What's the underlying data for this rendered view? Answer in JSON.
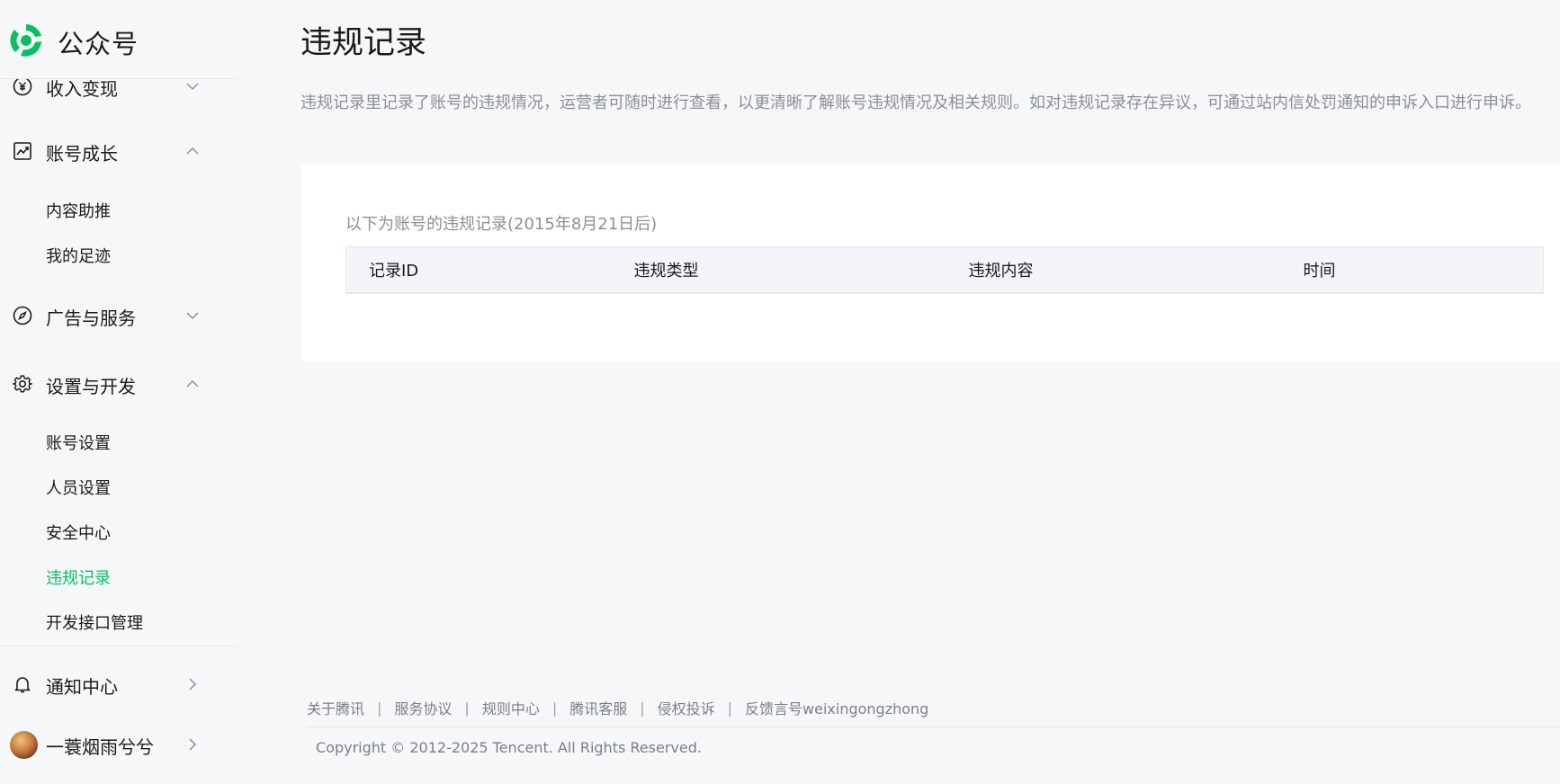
{
  "app": {
    "name": "公众号"
  },
  "sidebar": {
    "groups": [
      {
        "label": "收入变现",
        "icon": "yen-circle-icon",
        "state": "collapsed"
      },
      {
        "label": "账号成长",
        "icon": "trend-chart-icon",
        "state": "expanded"
      },
      {
        "label": "广告与服务",
        "icon": "compass-icon",
        "state": "collapsed"
      },
      {
        "label": "设置与开发",
        "icon": "gear-icon",
        "state": "expanded"
      },
      {
        "label": "通知中心",
        "icon": "bell-icon",
        "state": "link"
      }
    ],
    "growth_items": [
      {
        "label": "内容助推"
      },
      {
        "label": "我的足迹"
      }
    ],
    "settings_items": [
      {
        "label": "账号设置"
      },
      {
        "label": "人员设置"
      },
      {
        "label": "安全中心"
      },
      {
        "label": "违规记录",
        "active": true
      },
      {
        "label": "开发接口管理"
      }
    ],
    "user": {
      "name": "一蓑烟雨兮兮"
    }
  },
  "main": {
    "title": "违规记录",
    "description": "违规记录里记录了账号的违规情况，运营者可随时进行查看，以更清晰了解账号违规情况及相关规则。如对违规记录存在异议，可通过站内信处罚通知的申诉入口进行申诉。",
    "card": {
      "caption": "以下为账号的违规记录(2015年8月21日后)",
      "columns": [
        "记录ID",
        "违规类型",
        "违规内容",
        "时间"
      ],
      "rows": []
    }
  },
  "footer": {
    "links": [
      "关于腾讯",
      "服务协议",
      "规则中心",
      "腾讯客服",
      "侵权投诉",
      "反馈言号weixingongzhong"
    ],
    "separator": "|",
    "copyright": "Copyright © 2012-2025 Tencent. All Rights Reserved."
  },
  "colors": {
    "accent": "#07c160",
    "background": "#f6f7f9",
    "card": "#ffffff",
    "muted_text": "#8a8f99"
  }
}
